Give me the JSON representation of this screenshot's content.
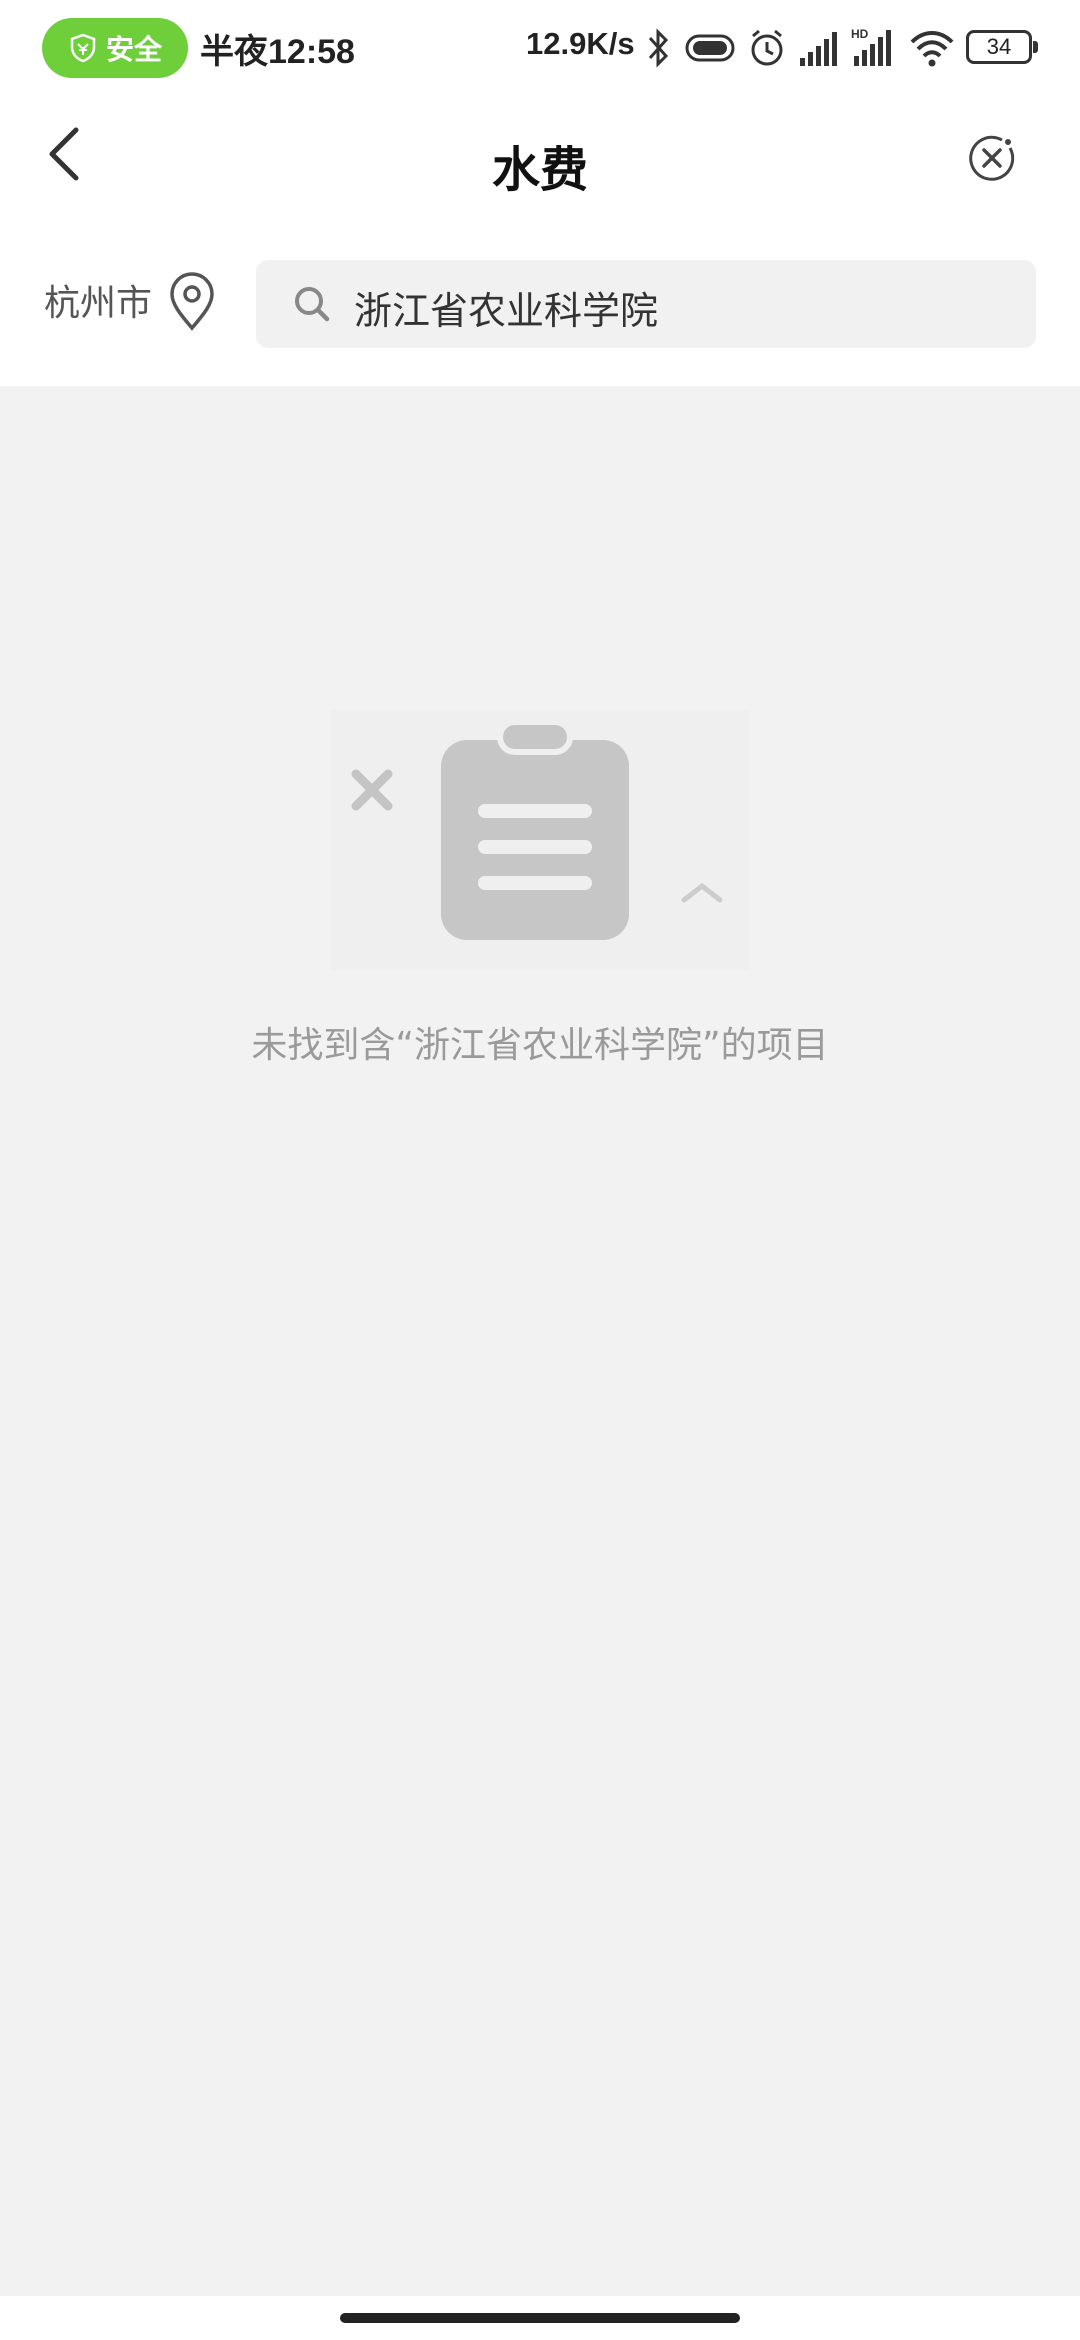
{
  "status_bar": {
    "safety_badge": "安全",
    "time": "半夜12:58",
    "net_speed": "12.9K/s",
    "battery": "34",
    "icons": [
      "shield-icon",
      "bluetooth-icon",
      "vibrate-icon",
      "alarm-icon",
      "signal-icon",
      "hd-signal-icon",
      "wifi-icon",
      "battery-icon"
    ]
  },
  "header": {
    "title": "水费",
    "back_icon": "back-arrow-icon",
    "close_icon": "close-circle-icon"
  },
  "search": {
    "city": "杭州市",
    "query": "浙江省农业科学院",
    "icon": "search-icon",
    "location_icon": "location-pin-icon"
  },
  "empty_state": {
    "icon": "empty-clipboard-icon",
    "message": "未找到含“浙江省农业科学院”的项目"
  },
  "colors": {
    "accent_green": "#6fcf3b",
    "background": "#f2f2f2",
    "muted_text": "#9a9a9a"
  }
}
